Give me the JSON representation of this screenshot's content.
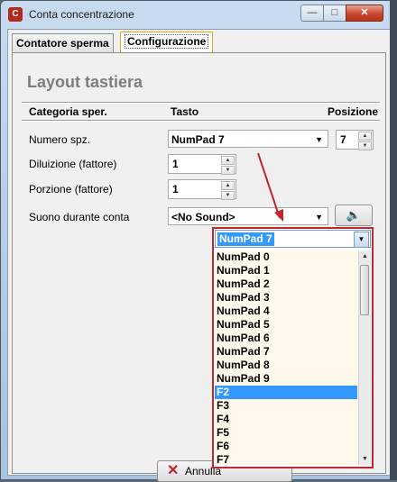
{
  "window": {
    "title": "Conta concentrazione",
    "buttons": {
      "minimize": "—",
      "maximize": "□",
      "close": "✕"
    },
    "icon_letter": "C"
  },
  "tabs": [
    {
      "label": "Contatore sperma",
      "active": false
    },
    {
      "label": "Configurazione",
      "active": true
    }
  ],
  "panel": {
    "heading": "Layout tastiera",
    "columns": {
      "category": "Categoria sper.",
      "key": "Tasto",
      "position": "Posizione"
    },
    "rows": {
      "numero": {
        "label": "Numero spz.",
        "key": "NumPad 7",
        "position": "7"
      },
      "diluizione": {
        "label": "Diluizione (fattore)",
        "value": "1"
      },
      "porzione": {
        "label": "Porzione (fattore)",
        "value": "1"
      },
      "suono": {
        "label": "Suono durante conta",
        "value": "<No Sound>"
      }
    },
    "cancel_label": "Annulla"
  },
  "dropdown": {
    "selected": "NumPad 7",
    "items": [
      "NumPad 0",
      "NumPad 1",
      "NumPad 2",
      "NumPad 3",
      "NumPad 4",
      "NumPad 5",
      "NumPad 6",
      "NumPad 7",
      "NumPad 8",
      "NumPad 9",
      "F2",
      "F3",
      "F4",
      "F5",
      "F6",
      "F7"
    ],
    "highlighted": "F2"
  },
  "colors": {
    "annotation_red": "#c1272d",
    "selection_blue": "#3399ff",
    "heading_gray": "#7d7d7d"
  }
}
